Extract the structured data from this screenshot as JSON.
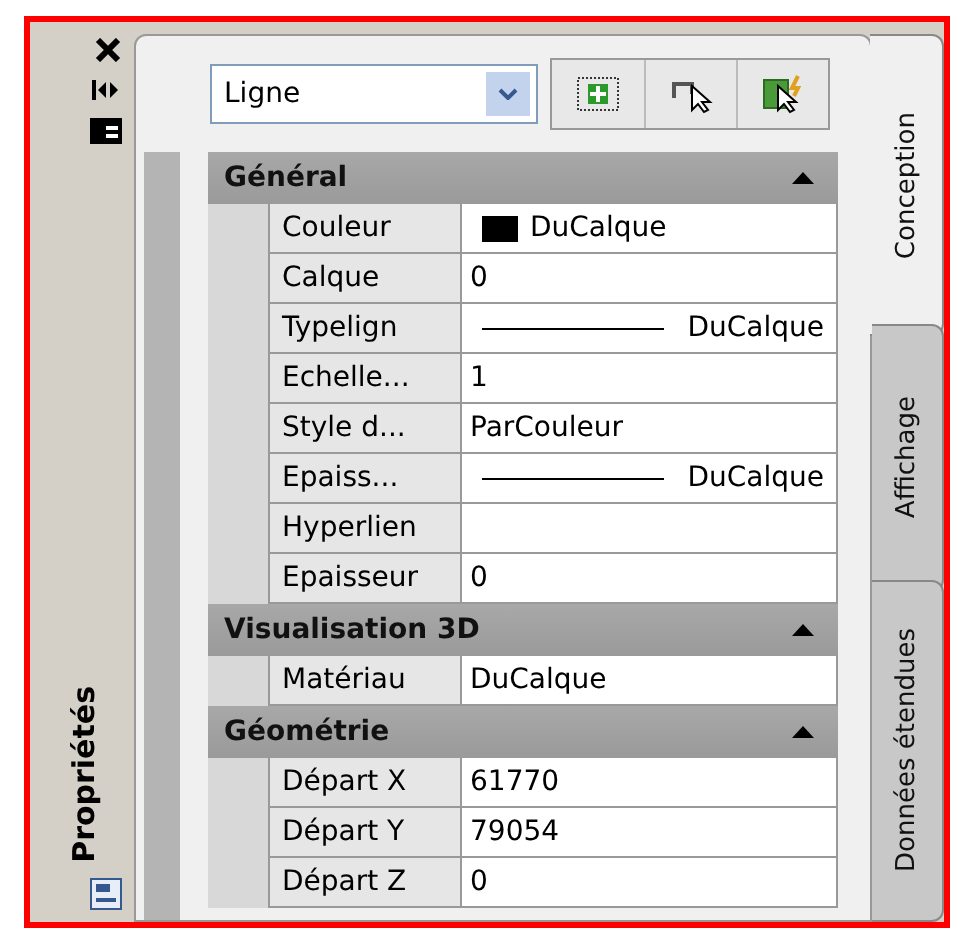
{
  "side_title": "Propriétés",
  "object_type": {
    "value": "Ligne"
  },
  "sections": [
    {
      "title": "Général",
      "expanded": true,
      "rows": [
        {
          "label": "Couleur",
          "value": "DuCalque",
          "kind": "swatch"
        },
        {
          "label": "Calque",
          "value": "0",
          "kind": "text"
        },
        {
          "label": "Typelign",
          "value": "DuCalque",
          "kind": "line"
        },
        {
          "label": "Echelle...",
          "value": "1",
          "kind": "text"
        },
        {
          "label": "Style d...",
          "value": "ParCouleur",
          "kind": "text"
        },
        {
          "label": "Epaiss...",
          "value": "DuCalque",
          "kind": "line"
        },
        {
          "label": "Hyperlien",
          "value": "",
          "kind": "text"
        },
        {
          "label": "Epaisseur",
          "value": "0",
          "kind": "text"
        }
      ]
    },
    {
      "title": "Visualisation 3D",
      "expanded": true,
      "rows": [
        {
          "label": "Matériau",
          "value": "DuCalque",
          "kind": "text"
        }
      ]
    },
    {
      "title": "Géométrie",
      "expanded": true,
      "rows": [
        {
          "label": "Départ X",
          "value": "61770",
          "kind": "text"
        },
        {
          "label": "Départ Y",
          "value": "79054",
          "kind": "text"
        },
        {
          "label": "Départ Z",
          "value": "0",
          "kind": "text"
        }
      ]
    }
  ],
  "tabs": [
    {
      "label": "Conception",
      "selected": true
    },
    {
      "label": "Affichage",
      "selected": false
    },
    {
      "label": "Données étendues",
      "selected": false
    }
  ]
}
